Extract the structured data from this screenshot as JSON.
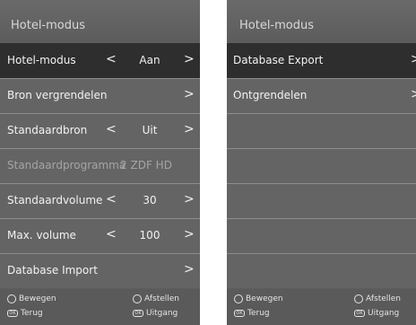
{
  "left_panel": {
    "title": "Hotel-modus",
    "rows": [
      {
        "label": "Hotel-modus",
        "left_arrow": "<",
        "value": "Aan",
        "right_arrow": ">"
      },
      {
        "label": "Bron vergrendelen",
        "right_arrow": ">"
      },
      {
        "label": "Standaardbron",
        "left_arrow": "<",
        "value": "Uit",
        "right_arrow": ">"
      },
      {
        "label": "Standaardprogramma",
        "value": "2 ZDF HD"
      },
      {
        "label": "Standaardvolume",
        "left_arrow": "<",
        "value": "30",
        "right_arrow": ">"
      },
      {
        "label": "Max. volume",
        "left_arrow": "<",
        "value": "100",
        "right_arrow": ">"
      },
      {
        "label": "Database Import",
        "right_arrow": ">"
      }
    ],
    "footer": {
      "move": "Bewegen",
      "adjust": "Afstellen",
      "back": "Terug",
      "exit": "Uitgang",
      "back_key": "OK",
      "exit_key": "OK"
    }
  },
  "right_panel": {
    "title": "Hotel-modus",
    "rows": [
      {
        "label": "Database Export",
        "right_arrow": ">"
      },
      {
        "label": "Ontgrendelen",
        "right_arrow": ">"
      }
    ],
    "footer": {
      "move": "Bewegen",
      "adjust": "Afstellen",
      "back": "Terug",
      "exit": "Uitgang",
      "back_key": "OK",
      "exit_key": "OK"
    }
  },
  "colors": {
    "panel": "#5d5d5d",
    "row": "#646464",
    "selected_row": "#2e2e2e",
    "text": "#f2f2f2",
    "disabled_text": "#a5a5a5"
  }
}
